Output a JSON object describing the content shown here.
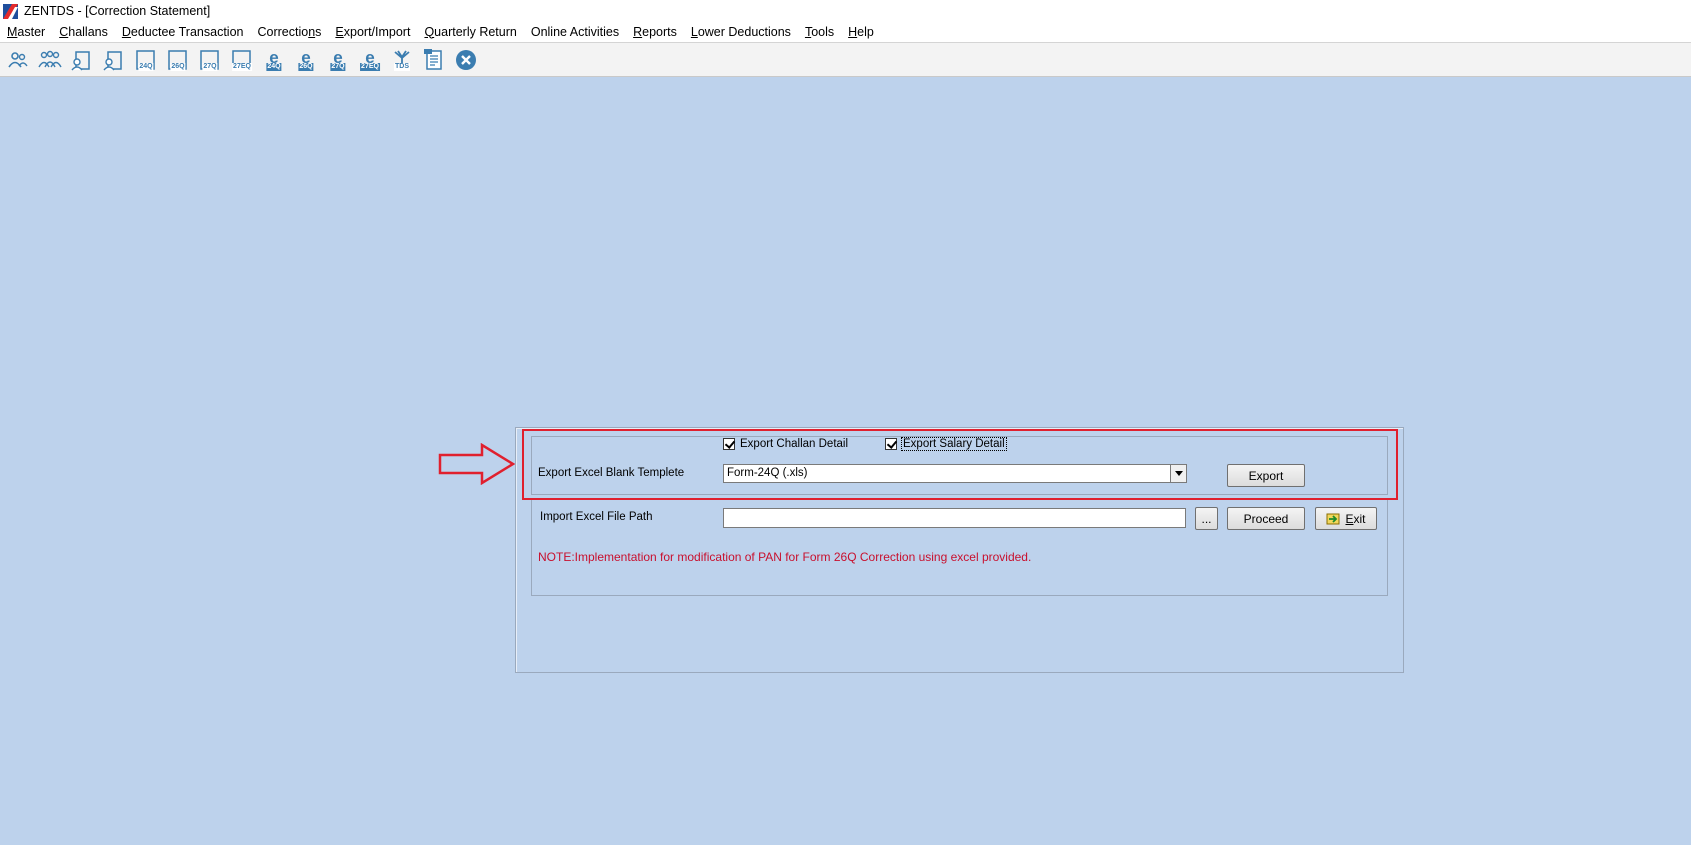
{
  "window": {
    "title": "ZENTDS - [Correction Statement]"
  },
  "menu": [
    {
      "accel": "M",
      "rest": "aster"
    },
    {
      "accel": "C",
      "rest": "hallans"
    },
    {
      "accel": "D",
      "rest": "eductee Transaction"
    },
    {
      "pre": "Correctio",
      "accel": "n",
      "rest": "s"
    },
    {
      "accel": "E",
      "rest": "xport/Import"
    },
    {
      "accel": "Q",
      "rest": "uarterly Return"
    },
    {
      "pre": "Online Activities",
      "accel": "",
      "rest": ""
    },
    {
      "accel": "R",
      "rest": "eports"
    },
    {
      "accel": "L",
      "rest": "ower Deductions"
    },
    {
      "accel": "T",
      "rest": "ools"
    },
    {
      "accel": "H",
      "rest": "elp"
    }
  ],
  "toolbar": {
    "labels": [
      "24Q",
      "26Q",
      "27Q",
      "27EQ",
      "24Q",
      "26Q",
      "27Q",
      "27EQ",
      "TDS"
    ]
  },
  "form": {
    "export_challan_label": "Export Challan Detail",
    "export_salary_label": "Export Salary Detail",
    "export_template_label": "Export Excel Blank Templete",
    "template_selected": "Form-24Q (.xls)",
    "export_button": "Export",
    "import_path_label": "Import Excel File Path",
    "import_path_value": "",
    "browse_button": "...",
    "proceed_button": "Proceed",
    "exit_accel": "E",
    "exit_rest": "xit",
    "note": "NOTE:Implementation for modification of PAN for Form 26Q Correction using excel provided."
  },
  "colors": {
    "background": "#bdd2ec",
    "highlight": "#e0202e",
    "note_text": "#c8102e",
    "icon_blue": "#3b7db0"
  }
}
